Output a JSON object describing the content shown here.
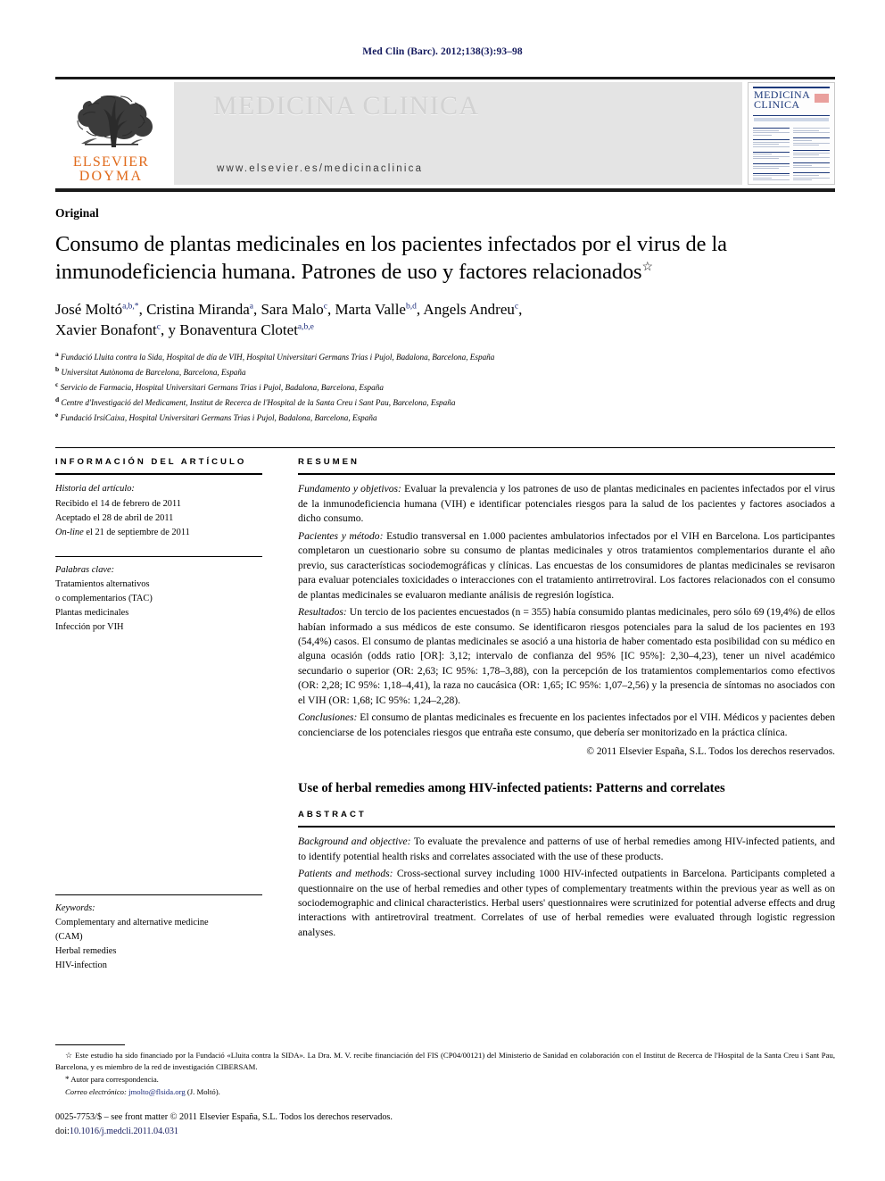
{
  "running_head": "Med Clin (Barc). 2012;138(3):93–98",
  "masthead": {
    "publisher_line1": "ELSEVIER",
    "publisher_line2": "DOYMA",
    "journal_name": "MEDICINA CLINICA",
    "journal_url": "www.elsevier.es/medicinaclinica",
    "cover_title_line1": "MEDICINA",
    "cover_title_line2": "CLINICA"
  },
  "article": {
    "kicker": "Original",
    "title": "Consumo de plantas medicinales en los pacientes infectados por el virus de la inmunodeficiencia humana. Patrones de uso y factores relacionados",
    "title_marker": "☆",
    "authors_line1_parts": [
      {
        "name": "José Moltó",
        "sup": "a,b,*"
      },
      {
        "name": "Cristina Miranda",
        "sup": "a"
      },
      {
        "name": "Sara Malo",
        "sup": "c"
      },
      {
        "name": "Marta Valle",
        "sup": "b,d"
      },
      {
        "name": "Angels Andreu",
        "sup": "c"
      }
    ],
    "authors_line2_parts": [
      {
        "name": "Xavier Bonafont",
        "sup": "c"
      },
      {
        "name": "y Bonaventura Clotet",
        "sup": "a,b,e"
      }
    ],
    "affiliations": [
      {
        "mark": "a",
        "text": "Fundació Lluita contra la Sida, Hospital de día de VIH, Hospital Universitari Germans Trias i Pujol, Badalona, Barcelona, España"
      },
      {
        "mark": "b",
        "text": "Universitat Autònoma de Barcelona, Barcelona, España"
      },
      {
        "mark": "c",
        "text": "Servicio de Farmacia, Hospital Universitari Germans Trias i Pujol, Badalona, Barcelona, España"
      },
      {
        "mark": "d",
        "text": "Centre d'Investigació del Medicament, Institut de Recerca de l'Hospital de la Santa Creu i Sant Pau, Barcelona, España"
      },
      {
        "mark": "e",
        "text": "Fundació IrsiCaixa, Hospital Universitari Germans Trias i Pujol, Badalona, Barcelona, España"
      }
    ]
  },
  "info_panel": {
    "heading": "INFORMACIÓN DEL ARTÍCULO",
    "history_label": "Historia del artículo:",
    "history": [
      "Recibido el 14 de febrero de 2011",
      "Aceptado el 28 de abril de 2011"
    ],
    "online_prefix": "On-line",
    "online_rest": " el 21 de septiembre de 2011",
    "keywords_label": "Palabras clave:",
    "keywords": [
      "Tratamientos alternativos",
      "o complementarios (TAC)",
      "Plantas medicinales",
      "Infección por VIH"
    ],
    "keywords_en_label": "Keywords:",
    "keywords_en": [
      "Complementary and alternative medicine",
      "(CAM)",
      "Herbal remedies",
      "HIV-infection"
    ]
  },
  "abstract_es": {
    "heading": "RESUMEN",
    "sections": [
      {
        "lead": "Fundamento y objetivos:",
        "body": " Evaluar la prevalencia y los patrones de uso de plantas medicinales en pacientes infectados por el virus de la inmunodeficiencia humana (VIH) e identificar potenciales riesgos para la salud de los pacientes y factores asociados a dicho consumo."
      },
      {
        "lead": "Pacientes y método:",
        "body": " Estudio transversal en 1.000 pacientes ambulatorios infectados por el VIH en Barcelona. Los participantes completaron un cuestionario sobre su consumo de plantas medicinales y otros tratamientos complementarios durante el año previo, sus características sociodemográficas y clínicas. Las encuestas de los consumidores de plantas medicinales se revisaron para evaluar potenciales toxicidades o interacciones con el tratamiento antirretroviral. Los factores relacionados con el consumo de plantas medicinales se evaluaron mediante análisis de regresión logística."
      },
      {
        "lead": "Resultados:",
        "body": " Un tercio de los pacientes encuestados (n = 355) había consumido plantas medicinales, pero sólo 69 (19,4%) de ellos habían informado a sus médicos de este consumo. Se identificaron riesgos potenciales para la salud de los pacientes en 193 (54,4%) casos. El consumo de plantas medicinales se asoció a una historia de haber comentado esta posibilidad con su médico en alguna ocasión (odds ratio [OR]: 3,12; intervalo de confianza del 95% [IC 95%]: 2,30–4,23), tener un nivel académico secundario o superior (OR: 2,63; IC 95%: 1,78–3,88), con la percepción de los tratamientos complementarios como efectivos (OR: 2,28; IC 95%: 1,18–4,41), la raza no caucásica (OR: 1,65; IC 95%: 1,07–2,56) y la presencia de síntomas no asociados con el VIH (OR: 1,68; IC 95%: 1,24–2,28)."
      },
      {
        "lead": "Conclusiones:",
        "body": " El consumo de plantas medicinales es frecuente en los pacientes infectados por el VIH. Médicos y pacientes deben concienciarse de los potenciales riesgos que entraña este consumo, que debería ser monitorizado en la práctica clínica."
      }
    ],
    "copyright": "© 2011 Elsevier España, S.L. Todos los derechos reservados."
  },
  "abstract_en": {
    "title": "Use of herbal remedies among HIV-infected patients: Patterns and correlates",
    "heading": "ABSTRACT",
    "sections": [
      {
        "lead": "Background and objective:",
        "body": " To evaluate the prevalence and patterns of use of herbal remedies among HIV-infected patients, and to identify potential health risks and correlates associated with the use of these products."
      },
      {
        "lead": "Patients and methods:",
        "body": " Cross-sectional survey including 1000 HIV-infected outpatients in Barcelona. Participants completed a questionnaire on the use of herbal remedies and other types of complementary treatments within the previous year as well as on sociodemographic and clinical characteristics. Herbal users' questionnaires were scrutinized for potential adverse effects and drug interactions with antiretroviral treatment. Correlates of use of herbal remedies were evaluated through logistic regression analyses."
      }
    ]
  },
  "footnotes": {
    "funding_mark": "☆",
    "funding": "Este estudio ha sido financiado por la Fundació «Lluita contra la SIDA». La Dra. M. V. recibe financiación del FIS (CP04/00121) del Ministerio de Sanidad en colaboración con el Institut de Recerca de l'Hospital de la Santa Creu i Sant Pau, Barcelona, y es miembro de la red de investigación CIBERSAM.",
    "corresponding_mark": "*",
    "corresponding": "Autor para correspondencia.",
    "email_label": "Correo electrónico:",
    "email": "jmolto@flsida.org",
    "email_suffix": " (J. Moltó)."
  },
  "colophon": {
    "issn_line": "0025-7753/$ – see front matter © 2011 Elsevier España, S.L. Todos los derechos reservados.",
    "doi_label": "doi:",
    "doi": "10.1016/j.medcli.2011.04.031"
  },
  "colors": {
    "running_head": "#141a5e",
    "elsevier_orange": "#e06a1b",
    "cover_blue": "#1e3a7b",
    "link_blue": "#1a2a7a"
  }
}
